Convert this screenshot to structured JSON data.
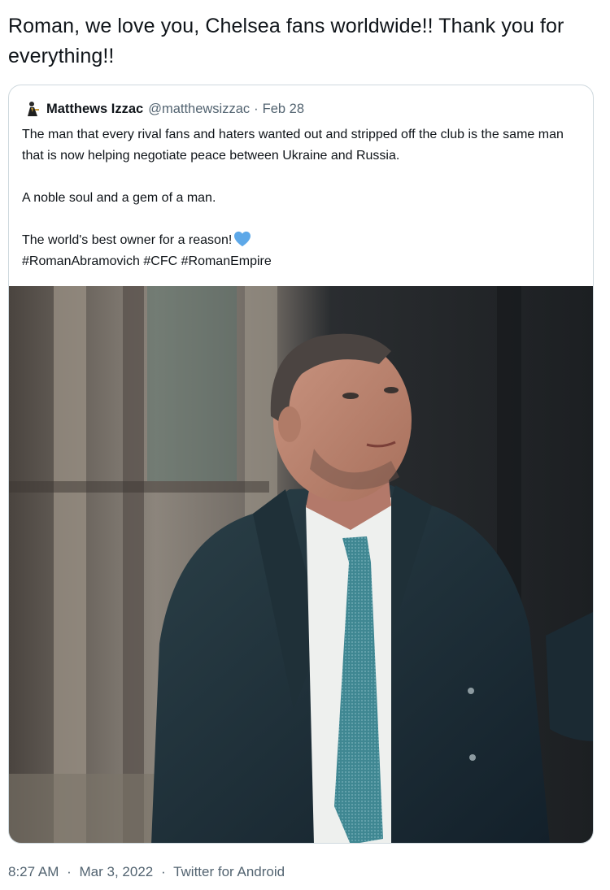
{
  "tweet": {
    "text": "Roman, we love you, Chelsea fans worldwide!! Thank you for everything!!",
    "quoted": {
      "name": "Matthews Izzac",
      "handle": "@matthewsizzac",
      "separator": "·",
      "date": "Feb 28",
      "paragraphs": [
        "The man that every rival fans and haters wanted out and stripped off the club is the same man that is now helping negotiate peace between Ukraine and Russia.",
        "A noble soul and a gem of a man.",
        "The world's best owner for a reason!"
      ],
      "hashtags": "#RomanAbramovich #CFC #RomanEmpire",
      "emoji": "blue-heart-icon"
    },
    "meta": {
      "time": "8:27 AM",
      "separator": "·",
      "date": "Mar 3, 2022",
      "source": "Twitter for Android"
    }
  },
  "colors": {
    "text": "#0f1419",
    "secondary": "#536471",
    "border": "#cfd9de",
    "heart": "#5da8e8"
  }
}
